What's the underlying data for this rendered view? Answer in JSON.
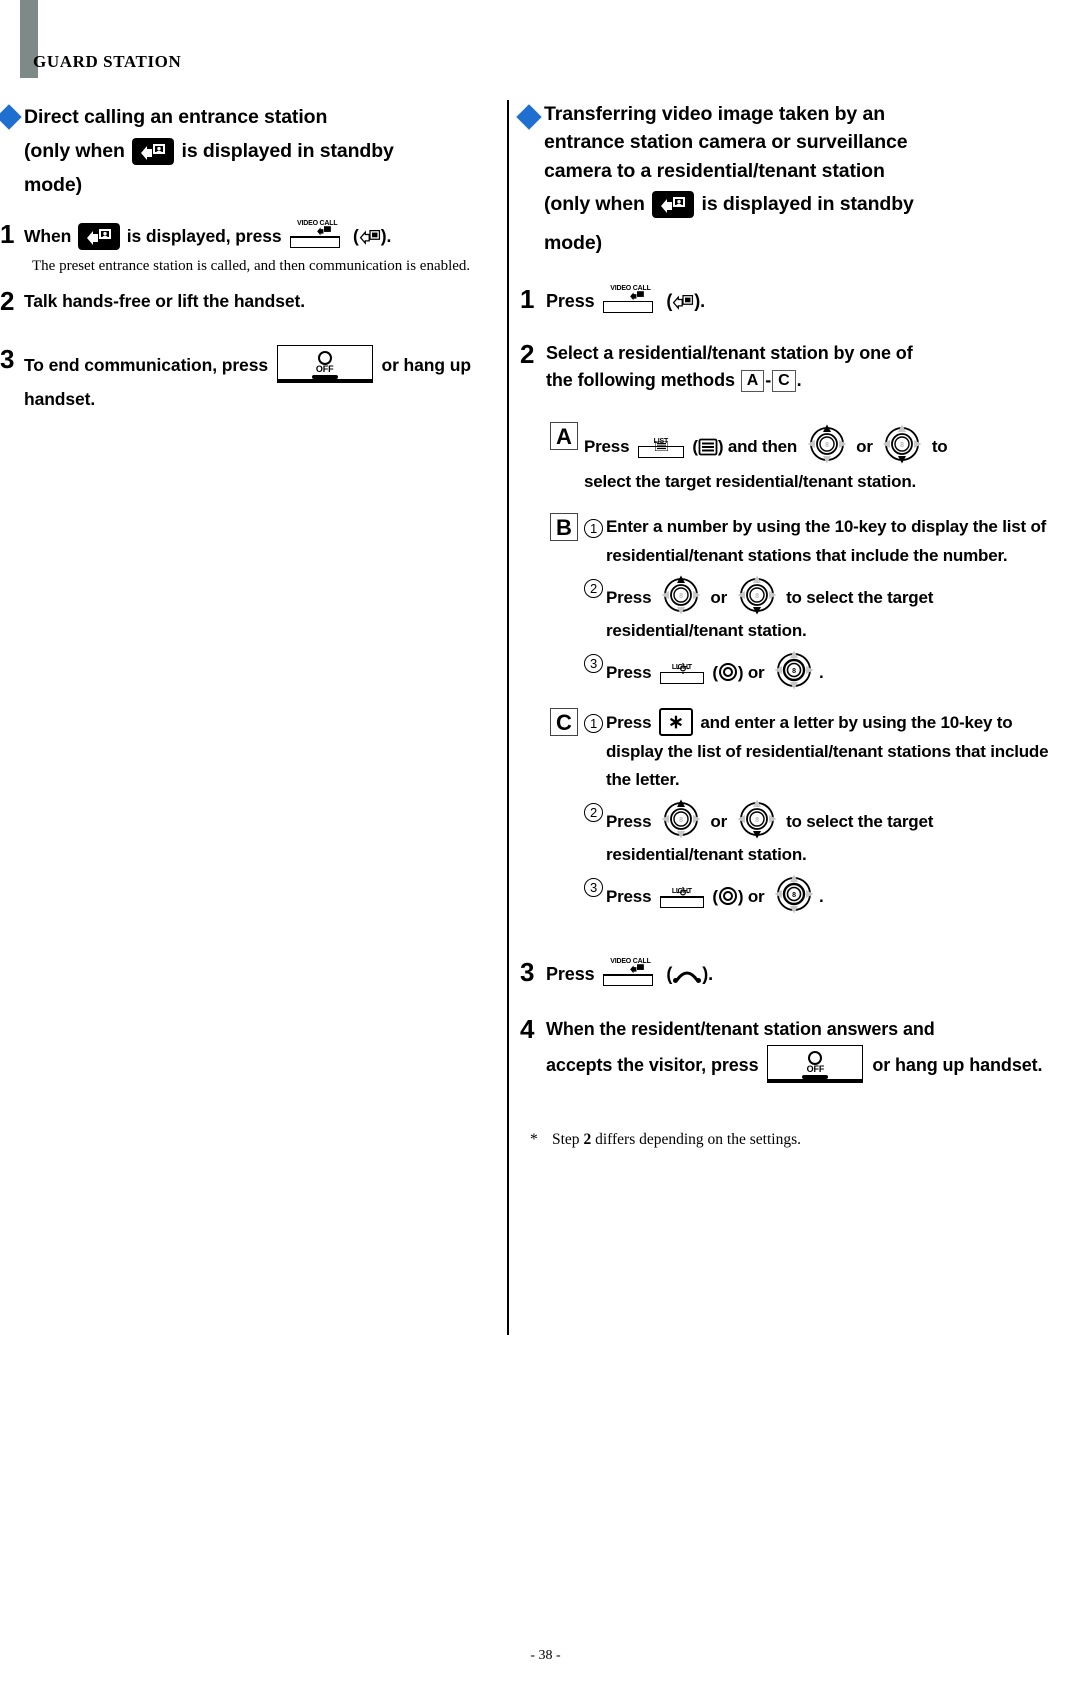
{
  "header": {
    "title": "GUARD STATION"
  },
  "page": {
    "number": "- 38 -"
  },
  "left_column": {
    "section": {
      "title_line1": "Direct calling an entrance station",
      "title_line2_a": "(only when",
      "title_line2_b": "is displayed in standby",
      "title_line3": "mode)"
    },
    "steps": [
      {
        "num": "1",
        "text_a": "When",
        "text_b": "is displayed, press",
        "text_c": "(",
        "text_d": ").",
        "note": "The preset entrance station is called, and then communication is enabled."
      },
      {
        "num": "2",
        "text_a": "Talk hands-free or lift the handset."
      },
      {
        "num": "3",
        "text_a": "To end communication, press",
        "text_b": "or hang up handset."
      }
    ]
  },
  "right_column": {
    "section": {
      "title_line1": "Transferring video image taken by an",
      "title_line2": "entrance station camera or surveillance",
      "title_line3": "camera to a residential/tenant station",
      "title_line4_a": "(only when",
      "title_line4_b": "is displayed in standby",
      "title_line5": "mode)"
    },
    "steps": [
      {
        "num": "1",
        "text_a": "Press",
        "text_b": "(",
        "text_c": ")."
      },
      {
        "num": "2",
        "text_a": "Select a residential/tenant station by one of",
        "text_b": "the following methods",
        "letter_a": "A",
        "dash": "-",
        "letter_c": "C",
        "text_c": "."
      },
      {
        "num": "3",
        "text_a": "Press",
        "text_b": "(",
        "text_c": ")."
      },
      {
        "num": "4",
        "text_a": "When the resident/tenant station answers and",
        "text_b": "accepts the visitor, press",
        "text_c": "or hang up handset."
      }
    ],
    "methods": [
      {
        "letter": "A",
        "lines": [
          {
            "seg1": "Press",
            "seg2": "(",
            "seg3": ") and then",
            "seg4": "or",
            "seg5": "to"
          },
          {
            "seg1": "select the target residential/tenant station."
          }
        ]
      },
      {
        "letter": "B",
        "subs": [
          {
            "num": "1",
            "text": "Enter a number by using the 10-key to display the list of residential/tenant stations that include the number."
          },
          {
            "num": "2",
            "seg1": "Press",
            "seg2": "or",
            "seg3": "to select the target",
            "seg4": "residential/tenant station."
          },
          {
            "num": "3",
            "seg1": "Press",
            "seg2": "(",
            "seg3": ") or",
            "seg4": "."
          }
        ]
      },
      {
        "letter": "C",
        "subs": [
          {
            "num": "1",
            "seg1": "Press",
            "seg2": "and enter a letter by using the 10-key to display the list of residential/tenant stations that include the letter."
          },
          {
            "num": "2",
            "seg1": "Press",
            "seg2": "or",
            "seg3": "to select the target",
            "seg4": "residential/tenant station."
          },
          {
            "num": "3",
            "seg1": "Press",
            "seg2": "(",
            "seg3": ") or",
            "seg4": "."
          }
        ]
      }
    ],
    "footnote": {
      "star": "*",
      "text_a": "Step",
      "bold": "2",
      "text_b": "differs depending on the settings."
    }
  },
  "keys": {
    "video_call_label": "VIDEO CALL",
    "list_label": "LIST",
    "light_label": "LIGHT",
    "off_label": "OFF",
    "star_label": "∗"
  },
  "colors": {
    "diamond": "#1f6fd0",
    "header_tab": "#7d8a88",
    "text": "#000000"
  }
}
